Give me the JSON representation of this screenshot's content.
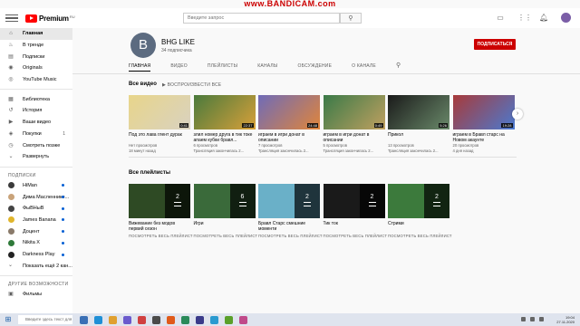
{
  "recorder": {
    "watermark": "www.BANDICAM.com"
  },
  "header": {
    "logo_text": "Premium",
    "logo_sup": "RU",
    "search_placeholder": "Введите запрос"
  },
  "sidebar": {
    "main": [
      {
        "label": "Главная",
        "icon": "home-icon"
      },
      {
        "label": "В тренде",
        "icon": "trending-icon"
      },
      {
        "label": "Подписки",
        "icon": "subscriptions-icon"
      },
      {
        "label": "Originals",
        "icon": "originals-icon"
      },
      {
        "label": "YouTube Music",
        "icon": "music-icon"
      }
    ],
    "library": [
      {
        "label": "Библиотека",
        "icon": "library-icon"
      },
      {
        "label": "История",
        "icon": "history-icon"
      },
      {
        "label": "Ваши видео",
        "icon": "your-videos-icon"
      },
      {
        "label": "Покупки",
        "icon": "purchases-icon",
        "count": "1"
      },
      {
        "label": "Смотреть позже",
        "icon": "watch-later-icon"
      },
      {
        "label": "Развернуть",
        "icon": "expand-icon"
      }
    ],
    "subs_heading": "ПОДПИСКИ",
    "subscriptions": [
      {
        "label": "HiMan",
        "color": "#3b3b3b"
      },
      {
        "label": "Дима Масленнике...",
        "color": "#c9a37a"
      },
      {
        "label": "ФыВНыВ",
        "color": "#444444"
      },
      {
        "label": "James Banana",
        "color": "#e0b52b"
      },
      {
        "label": "Доцент",
        "color": "#8a7a6a"
      },
      {
        "label": "Nikita X",
        "color": "#2f7a3a"
      },
      {
        "label": "Darkness Play",
        "color": "#222222"
      },
      {
        "label": "Показать ещё 2 кан...",
        "color": ""
      }
    ],
    "more_heading": "ДРУГИЕ ВОЗМОЖНОСТИ",
    "more": [
      {
        "label": "Фильмы",
        "icon": "movies-icon"
      }
    ]
  },
  "channel": {
    "avatar_letter": "B",
    "name": "BHG LIKE",
    "subscribers": "34 подписчика",
    "subscribe_label": "ПОДПИСАТЬСЯ",
    "tabs": [
      "ГЛАВНАЯ",
      "ВИДЕО",
      "ПЛЕЙЛИСТЫ",
      "КАНАЛЫ",
      "ОБСУЖДЕНИЕ",
      "О КАНАЛЕ"
    ]
  },
  "videos_shelf": {
    "title": "Все видео",
    "play_all": "ВОСПРОИЗВЕСТИ ВСЕ",
    "items": [
      {
        "title": "Под это лава глент дурак",
        "meta1": "Нет просмотров",
        "meta2": "18 минут назад",
        "duration": "0:41",
        "color": "#e8d58a",
        "accent": "#d9d2c0"
      },
      {
        "title": "злил номер друга в тик токе апаем кубки бравл...",
        "meta1": "6 просмотров",
        "meta2": "Трансляция закончилась 2...",
        "duration": "22:37",
        "color": "#4a7a3c",
        "accent": "#d8a03a"
      },
      {
        "title": "играем в игри донат в описании",
        "meta1": "7 просмотров",
        "meta2": "Трансляция закончилась 2...",
        "duration": "24:48",
        "color": "#6f6bb8",
        "accent": "#e0853a"
      },
      {
        "title": "играем в игри донат в описании",
        "meta1": "5 просмотров",
        "meta2": "Трансляция закончилась 2...",
        "duration": "0:49",
        "color": "#3a7a48",
        "accent": "#c0a060"
      },
      {
        "title": "Прикол",
        "meta1": "13 просмотров",
        "meta2": "Трансляция закончилась 2...",
        "duration": "5:26",
        "color": "#1a1a1a",
        "accent": "#6a8a6a"
      },
      {
        "title": "играем в Бравл старс на Новом акаунте",
        "meta1": "20 просмотров",
        "meta2": "4 дня назад",
        "duration": "19:28",
        "color": "#a83a3a",
        "accent": "#4a7ad0"
      }
    ]
  },
  "playlists_shelf": {
    "title": "Все плейлисты",
    "link_label": "ПОСМОТРЕТЬ ВЕСЬ ПЛЕЙЛИСТ",
    "items": [
      {
        "title": "Вижевание без модов первий сезон",
        "count": "2",
        "color": "#2e4a24"
      },
      {
        "title": "Игри",
        "count": "6",
        "color": "#3a6a3a"
      },
      {
        "title": "Бравл Старс смешние моменти",
        "count": "2",
        "color": "#6ab0c8"
      },
      {
        "title": "Тик ток",
        "count": "2",
        "color": "#1a1a1a"
      },
      {
        "title": "Стрими",
        "count": "2",
        "color": "#3c7a3c"
      }
    ]
  },
  "taskbar": {
    "search_placeholder": "Введите здесь текст для поиска",
    "time": "19:04",
    "date": "27.11.2020"
  }
}
